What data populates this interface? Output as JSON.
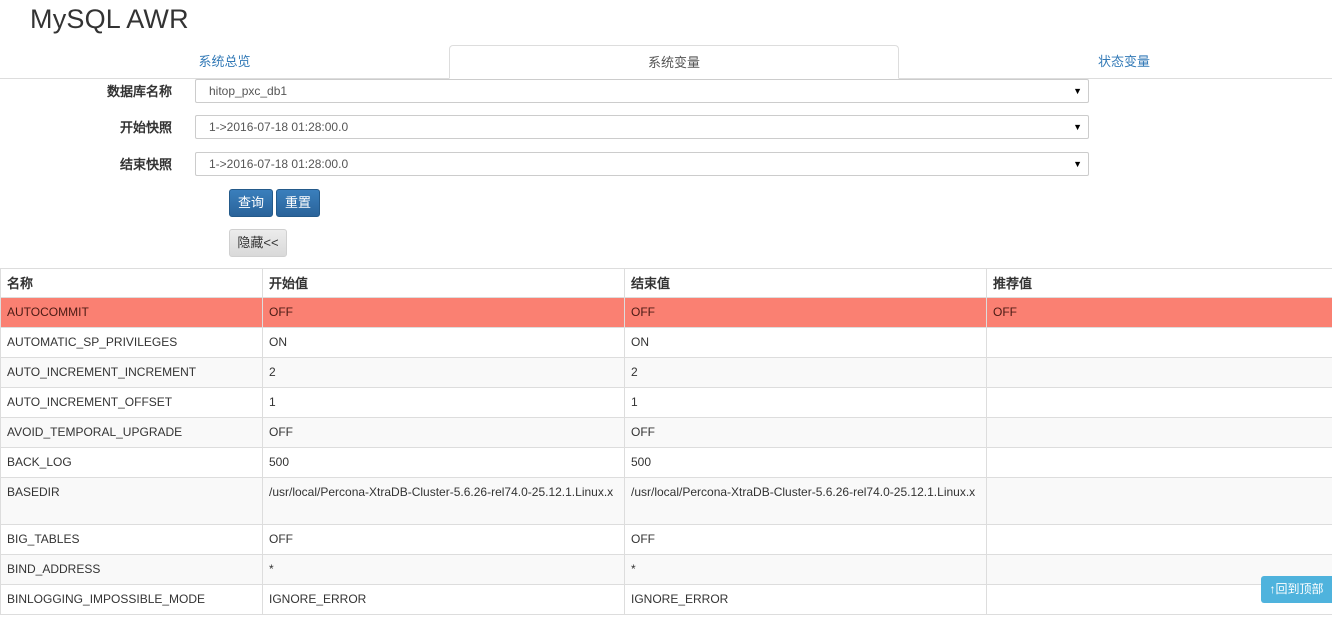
{
  "app": {
    "title": "MySQL AWR"
  },
  "tabs": [
    {
      "label": "系统总览",
      "active": false
    },
    {
      "label": "系统变量",
      "active": true
    },
    {
      "label": "状态变量",
      "active": false
    }
  ],
  "form": {
    "database": {
      "label": "数据库名称",
      "value": "hitop_pxc_db1"
    },
    "start_snapshot": {
      "label": "开始快照",
      "value": "1->2016-07-18 01:28:00.0"
    },
    "end_snapshot": {
      "label": "结束快照",
      "value": "1->2016-07-18 01:28:00.0"
    },
    "arrow": "▼",
    "query_label": "查询",
    "reset_label": "重置",
    "hide_label": "隐藏<<"
  },
  "table": {
    "headers": [
      "名称",
      "开始值",
      "结束值",
      "推荐值"
    ],
    "rows": [
      [
        "AUTOCOMMIT",
        "OFF",
        "OFF",
        "OFF"
      ],
      [
        "AUTOMATIC_SP_PRIVILEGES",
        "ON",
        "ON",
        ""
      ],
      [
        "AUTO_INCREMENT_INCREMENT",
        "2",
        "2",
        ""
      ],
      [
        "AUTO_INCREMENT_OFFSET",
        "1",
        "1",
        ""
      ],
      [
        "AVOID_TEMPORAL_UPGRADE",
        "OFF",
        "OFF",
        ""
      ],
      [
        "BACK_LOG",
        "500",
        "500",
        ""
      ],
      [
        "BASEDIR",
        "/usr/local/Percona-XtraDB-Cluster-5.6.26-rel74.0-25.12.1.Linux.x",
        "/usr/local/Percona-XtraDB-Cluster-5.6.26-rel74.0-25.12.1.Linux.x",
        ""
      ],
      [
        "BIG_TABLES",
        "OFF",
        "OFF",
        ""
      ],
      [
        "BIND_ADDRESS",
        "*",
        "*",
        ""
      ],
      [
        "BINLOGGING_IMPOSSIBLE_MODE",
        "IGNORE_ERROR",
        "IGNORE_ERROR",
        ""
      ]
    ]
  },
  "back_to_top": {
    "label": "↑回到顶部"
  },
  "colors": {
    "highlight_row": "#fa8072",
    "tab_link": "#337ab7",
    "primary_button": "#2f6ea6",
    "back_to_top": "#4fb3dd"
  }
}
